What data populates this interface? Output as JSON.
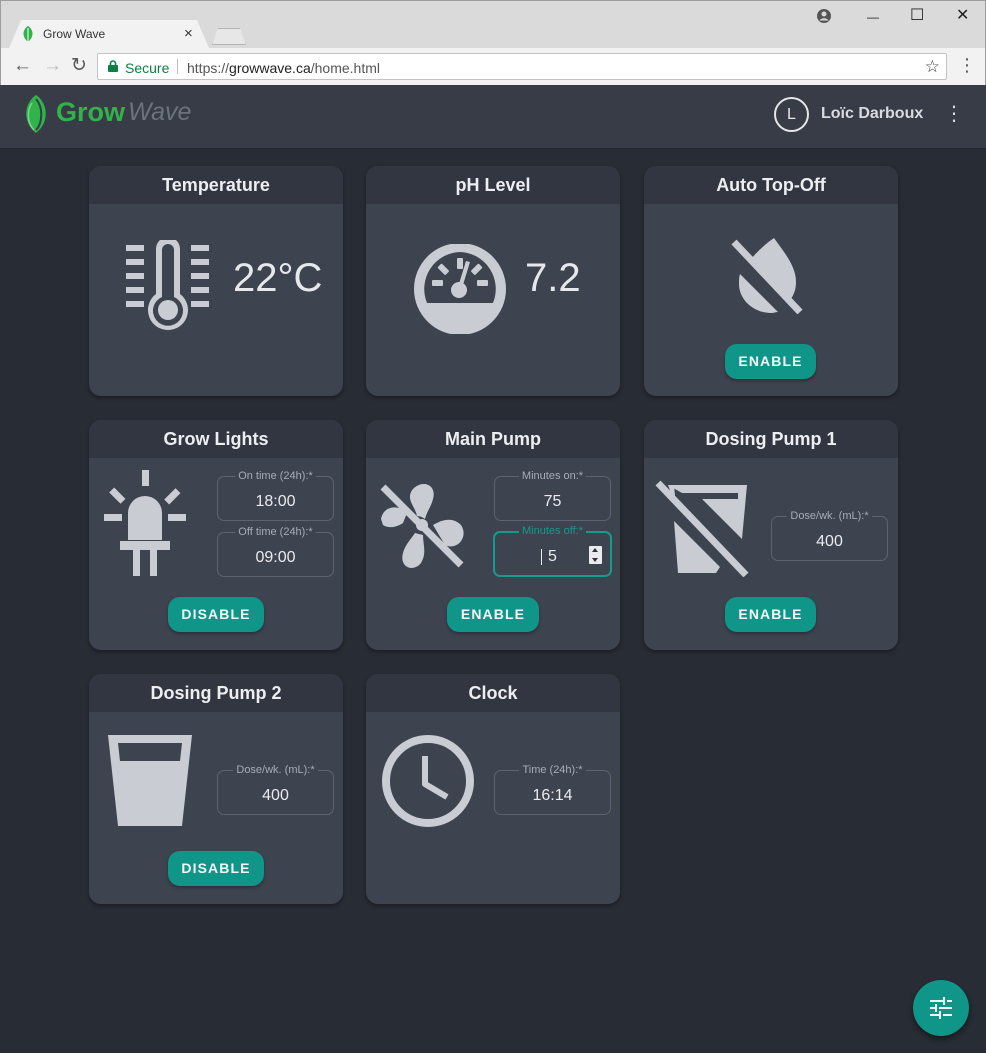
{
  "browser": {
    "tab_title": "Grow Wave",
    "tab_close": "×",
    "secure_label": "Secure",
    "url_scheme": "https://",
    "url_host": "growwave.ca",
    "url_path": "/home.html",
    "back": "←",
    "forward": "→",
    "reload": "↻",
    "star": "☆",
    "menu": "⋮",
    "minimize": "—",
    "maximize": "☐",
    "close": "✕"
  },
  "app": {
    "logo_grow": "Grow",
    "logo_wave": "Wave",
    "user_initial": "L",
    "user_name": "Loïc Darboux",
    "menu_glyph": "⋮"
  },
  "cards": {
    "temperature": {
      "title": "Temperature",
      "value": "22°C",
      "icon": "thermometer-icon"
    },
    "ph": {
      "title": "pH Level",
      "value": "7.2",
      "icon": "gauge-icon"
    },
    "auto_top_off": {
      "title": "Auto Top-Off",
      "button": "ENABLE",
      "icon": "water-off-icon"
    },
    "grow_lights": {
      "title": "Grow Lights",
      "on_label": "On time (24h):*",
      "on_value": "18:00",
      "off_label": "Off time (24h):*",
      "off_value": "09:00",
      "button": "DISABLE",
      "icon": "led-icon"
    },
    "main_pump": {
      "title": "Main Pump",
      "on_label": "Minutes on:*",
      "on_value": "75",
      "off_label": "Minutes off:*",
      "off_value": "5",
      "button": "ENABLE",
      "icon": "fan-off-icon"
    },
    "dosing_pump_1": {
      "title": "Dosing Pump 1",
      "dose_label": "Dose/wk. (mL):*",
      "dose_value": "400",
      "button": "ENABLE",
      "icon": "cup-off-icon"
    },
    "dosing_pump_2": {
      "title": "Dosing Pump 2",
      "dose_label": "Dose/wk. (mL):*",
      "dose_value": "400",
      "button": "DISABLE",
      "icon": "cup-icon"
    },
    "clock": {
      "title": "Clock",
      "time_label": "Time (24h):*",
      "time_value": "16:14",
      "icon": "clock-icon"
    }
  },
  "fab": {
    "icon": "tune-icon"
  },
  "colors": {
    "background": "#282c34",
    "card": "#3e4350",
    "card_header": "#323641",
    "accent": "#0f9688",
    "brand_green": "#2fb34a"
  }
}
